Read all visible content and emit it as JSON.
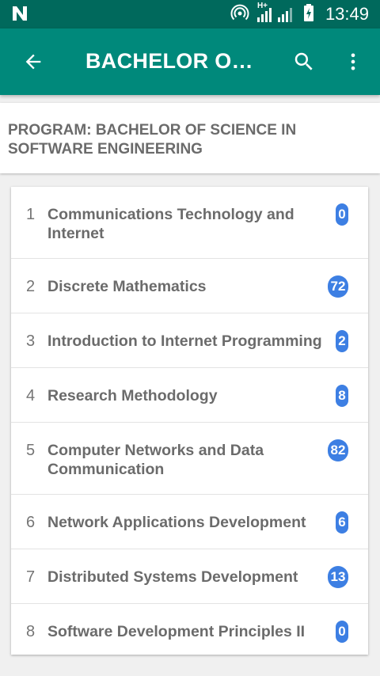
{
  "status_bar": {
    "time": "13:49",
    "network_label": "H+",
    "icons": [
      "notification-n-icon",
      "hotspot-icon",
      "signal-icon",
      "battery-charging-icon"
    ]
  },
  "toolbar": {
    "title": "BACHELOR OF SCIENCE IN SOFTWARE ENGINEERING",
    "back_icon": "arrow-back-icon",
    "search_icon": "search-icon",
    "more_icon": "more-vert-icon",
    "background_color": "#00897b",
    "status_color": "#00695c"
  },
  "program": {
    "heading": "PROGRAM: BACHELOR OF SCIENCE IN SOFTWARE ENGINEERING"
  },
  "badge_color": "#3d7fe3",
  "courses": [
    {
      "number": "1",
      "name": "Communications Technology and Internet",
      "count": "0"
    },
    {
      "number": "2",
      "name": "Discrete Mathematics",
      "count": "72"
    },
    {
      "number": "3",
      "name": "Introduction to Internet Programming",
      "count": "2"
    },
    {
      "number": "4",
      "name": "Research Methodology",
      "count": "8"
    },
    {
      "number": "5",
      "name": "Computer Networks and Data Communication",
      "count": "82"
    },
    {
      "number": "6",
      "name": "Network Applications Development",
      "count": "6"
    },
    {
      "number": "7",
      "name": "Distributed Systems Development",
      "count": "13"
    },
    {
      "number": "8",
      "name": "Software Development Principles II",
      "count": "0"
    }
  ]
}
